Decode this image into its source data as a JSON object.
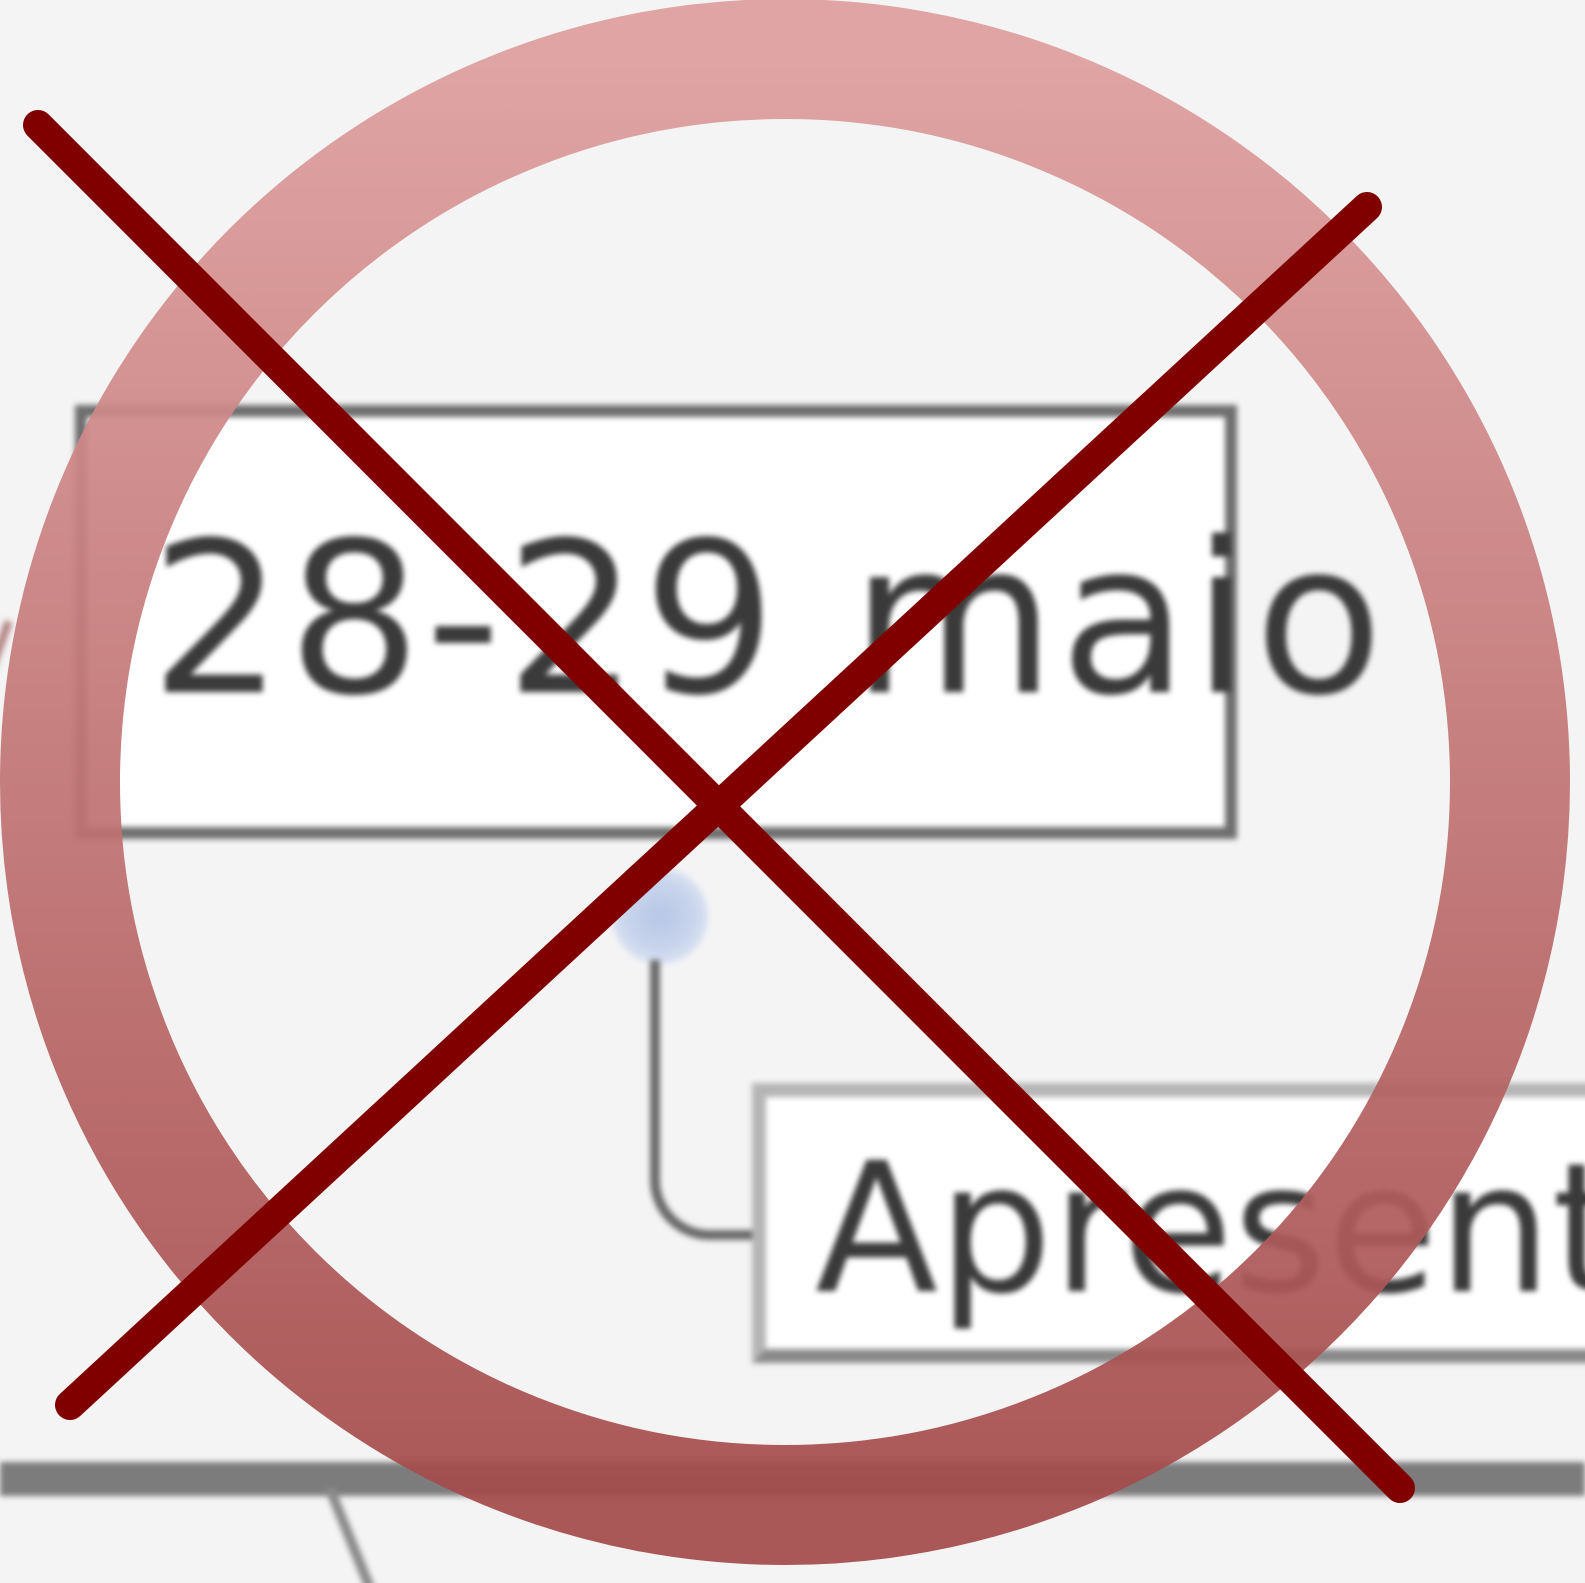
{
  "timeline": {
    "date_label": "28-29 maio",
    "node_label": "Apresentaç"
  },
  "overlay": {
    "symbol": "prohibition-icon",
    "ring_color_top": "#dd9d9d",
    "ring_color_bottom": "#a44a4a",
    "cross_color": "#800000"
  },
  "colors": {
    "background": "#f4f4f4",
    "box_border": "#6e6e6e",
    "connector_dot": "#b7c7e6"
  }
}
